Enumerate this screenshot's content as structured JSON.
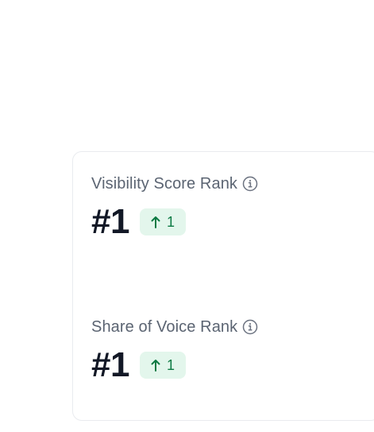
{
  "metrics": [
    {
      "label": "Visibility Score Rank",
      "value": "#1",
      "change": "1",
      "change_icon": "arrow-up-icon",
      "info_icon": "info-circle-icon"
    },
    {
      "label": "Share of Voice Rank",
      "value": "#1",
      "change": "1",
      "change_icon": "arrow-up-icon",
      "info_icon": "info-circle-icon"
    }
  ],
  "colors": {
    "label": "#5b6472",
    "value": "#121826",
    "badge_bg": "#e3f6ec",
    "badge_text": "#0c7a43",
    "card_border": "#e9ebef"
  }
}
